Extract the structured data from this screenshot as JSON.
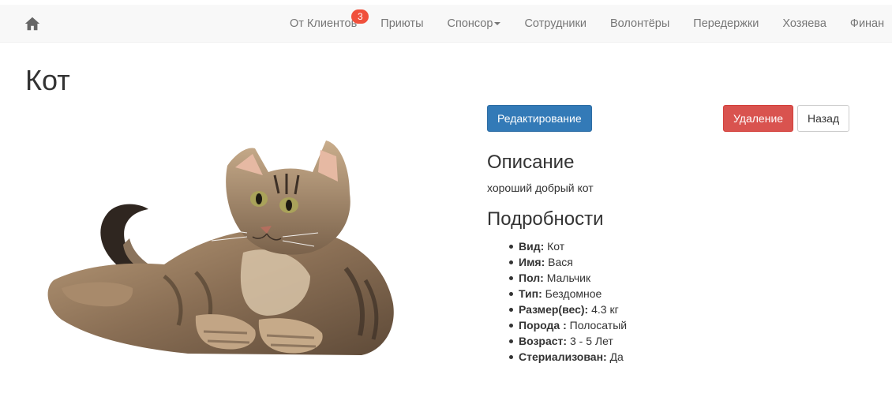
{
  "navbar": {
    "home_icon": "home-icon",
    "items": [
      {
        "label": "От Клиентов",
        "badge": "3"
      },
      {
        "label": "Приюты"
      },
      {
        "label": "Спонсор",
        "dropdown": true
      },
      {
        "label": "Сотрудники"
      },
      {
        "label": "Волонтёры"
      },
      {
        "label": "Передержки"
      },
      {
        "label": "Хозяева"
      },
      {
        "label": "Финан"
      }
    ]
  },
  "page": {
    "title": "Кот",
    "image_alt": "cat-photo"
  },
  "actions": {
    "edit_label": "Редактирование",
    "delete_label": "Удаление",
    "back_label": "Назад"
  },
  "description": {
    "title": "Описание",
    "text": "хороший добрый кот"
  },
  "details": {
    "title": "Подробности",
    "items": [
      {
        "key": "Вид:",
        "value": "Кот"
      },
      {
        "key": "Имя:",
        "value": "Вася"
      },
      {
        "key": "Пол:",
        "value": "Мальчик"
      },
      {
        "key": "Тип:",
        "value": "Бездомное"
      },
      {
        "key": "Размер(вес):",
        "value": "4.3 кг"
      },
      {
        "key": "Порода :",
        "value": "Полосатый"
      },
      {
        "key": "Возраст:",
        "value": "3 - 5 Лет"
      },
      {
        "key": "Стериализован:",
        "value": "Да"
      }
    ]
  },
  "colors": {
    "navbar_bg": "#f8f8f8",
    "nav_text": "#777777",
    "badge": "#f0503c",
    "primary": "#337ab7",
    "danger": "#d9534f"
  }
}
